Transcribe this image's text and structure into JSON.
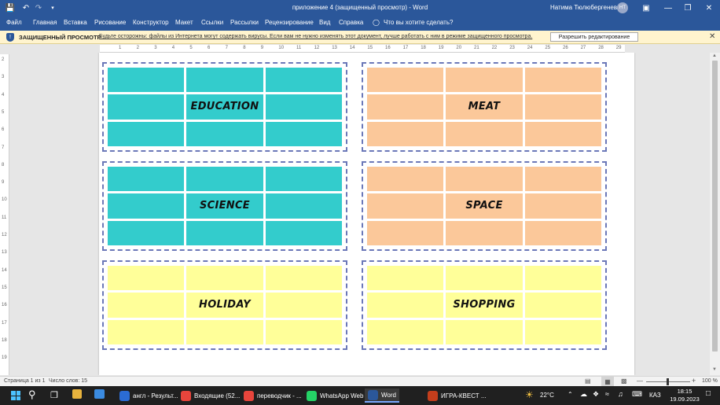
{
  "window": {
    "title": "приложение 4 (защищенный просмотр)  -  Word",
    "user_name": "Натима Тюлюбергенева",
    "user_initials": "НТ"
  },
  "ribbon": {
    "tabs": [
      "Файл",
      "Главная",
      "Вставка",
      "Рисование",
      "Конструктор",
      "Макет",
      "Ссылки",
      "Рассылки",
      "Рецензирование",
      "Вид",
      "Справка"
    ],
    "tell_me": "Что вы хотите сделать?"
  },
  "protected_view": {
    "title": "ЗАЩИЩЕННЫЙ ПРОСМОТР",
    "message": "Будьте осторожны: файлы из Интернета могут содержать вирусы. Если вам не нужно изменять этот документ, лучше работать с ним в режиме защищенного просмотра.",
    "enable_button": "Разрешить редактирование"
  },
  "ruler": {
    "h_ticks": [
      "1",
      "2",
      "3",
      "4",
      "5",
      "6",
      "7",
      "8",
      "9",
      "10",
      "11",
      "12",
      "13",
      "14",
      "15",
      "16",
      "17",
      "18",
      "19",
      "20",
      "21",
      "22",
      "23",
      "24",
      "25",
      "26",
      "27",
      "28",
      "29"
    ],
    "v_ticks": [
      "2",
      "3",
      "4",
      "5",
      "6",
      "7",
      "8",
      "9",
      "10",
      "11",
      "12",
      "13",
      "14",
      "15",
      "16",
      "17",
      "18",
      "19"
    ]
  },
  "cards": [
    {
      "label": "EDUCATION",
      "color": "#33cccc"
    },
    {
      "label": "MEAT",
      "color": "#fbc89a"
    },
    {
      "label": "SCIENCE",
      "color": "#33cccc"
    },
    {
      "label": "SPACE",
      "color": "#fbc89a"
    },
    {
      "label": "HOLIDAY",
      "color": "#ffff99"
    },
    {
      "label": "SHOPPING",
      "color": "#ffff99"
    }
  ],
  "status": {
    "page": "Страница 1 из 1",
    "words": "Число слов: 15",
    "zoom": "100 %"
  },
  "taskbar": {
    "items": [
      {
        "label": "англ - Результ...",
        "color": "#2b6cd4"
      },
      {
        "label": "Входящие (52...",
        "color": "#e8453c"
      },
      {
        "label": "переводчик - ...",
        "color": "#e8453c"
      },
      {
        "label": "WhatsApp Web",
        "color": "#25d366"
      },
      {
        "label": "Word",
        "color": "#2b579a"
      },
      {
        "label": "ИГРА-КВЕСТ ...",
        "color": "#c43e1c"
      }
    ],
    "weather": "22°C",
    "lang": "КАЗ",
    "time": "18:15",
    "date": "19.09.2023"
  }
}
